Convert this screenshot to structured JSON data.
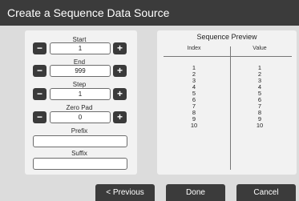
{
  "dialog": {
    "title": "Create a Sequence Data Source"
  },
  "fields": {
    "start": {
      "label": "Start",
      "value": "1"
    },
    "end": {
      "label": "End",
      "value": "999"
    },
    "step": {
      "label": "Step",
      "value": "1"
    },
    "zero_pad": {
      "label": "Zero Pad",
      "value": "0"
    },
    "prefix": {
      "label": "Prefix",
      "value": ""
    },
    "suffix": {
      "label": "Suffix",
      "value": ""
    }
  },
  "stepper": {
    "minus_symbol": "−",
    "plus_symbol": "+"
  },
  "preview": {
    "title": "Sequence Preview",
    "index_header": "Index",
    "value_header": "Value",
    "rows": [
      {
        "index": "1",
        "value": "1"
      },
      {
        "index": "2",
        "value": "2"
      },
      {
        "index": "3",
        "value": "3"
      },
      {
        "index": "4",
        "value": "4"
      },
      {
        "index": "5",
        "value": "5"
      },
      {
        "index": "6",
        "value": "6"
      },
      {
        "index": "7",
        "value": "7"
      },
      {
        "index": "8",
        "value": "8"
      },
      {
        "index": "9",
        "value": "9"
      },
      {
        "index": "10",
        "value": "10"
      }
    ]
  },
  "buttons": {
    "previous": "< Previous",
    "done": "Done",
    "cancel": "Cancel"
  },
  "colors": {
    "titlebar": "#3b3b3b",
    "panel": "#f2f2f2",
    "background": "#dcdcdc",
    "button": "#3b3b3b"
  }
}
